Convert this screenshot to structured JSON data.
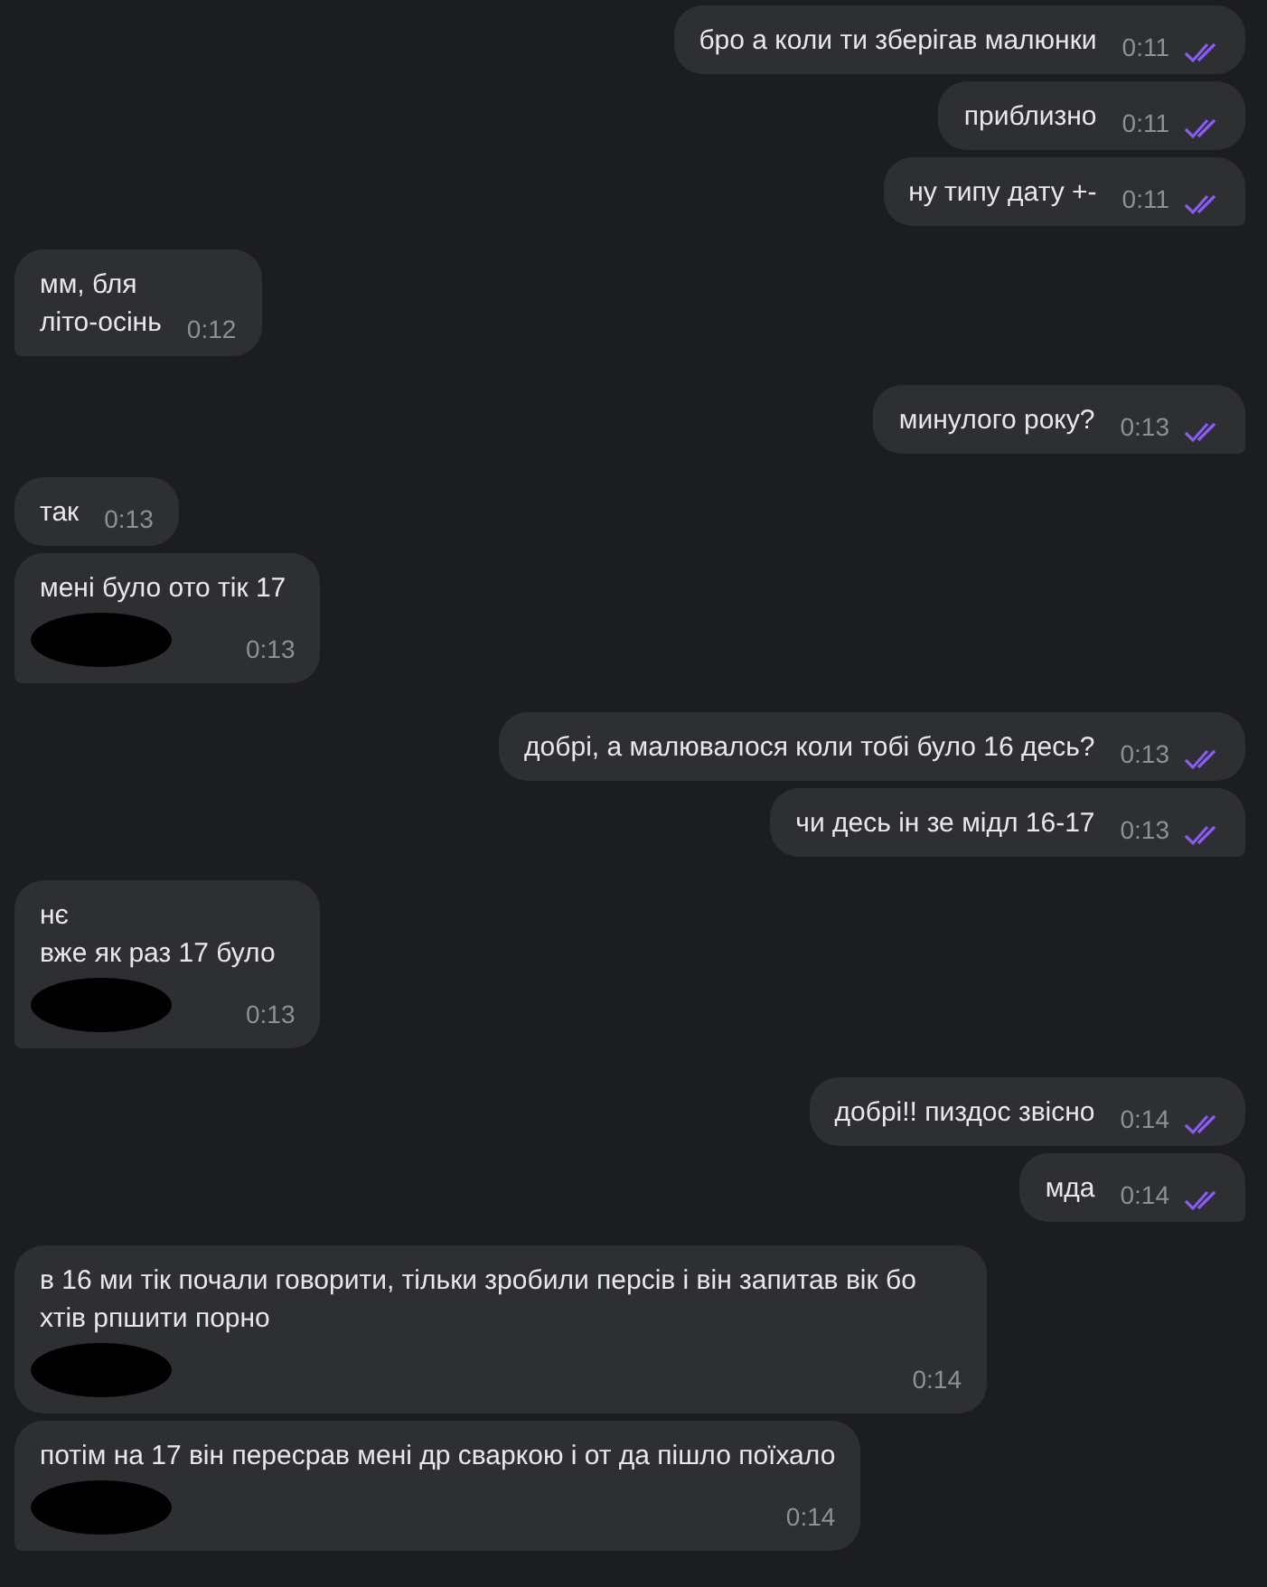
{
  "groups": [
    {
      "outgoing": true,
      "messages": [
        {
          "lines": [
            "бро а коли ти зберігав малюнки"
          ],
          "time": "0:11",
          "read": true,
          "redacted": false
        },
        {
          "lines": [
            "приблизно"
          ],
          "time": "0:11",
          "read": true,
          "redacted": false
        },
        {
          "lines": [
            "ну типу дату +-"
          ],
          "time": "0:11",
          "read": true,
          "redacted": false
        }
      ]
    },
    {
      "outgoing": false,
      "messages": [
        {
          "lines": [
            "мм, бля",
            "літо-осінь"
          ],
          "time": "0:12",
          "redacted": false
        }
      ]
    },
    {
      "outgoing": true,
      "messages": [
        {
          "lines": [
            "минулого року?"
          ],
          "time": "0:13",
          "read": true,
          "redacted": false
        }
      ]
    },
    {
      "outgoing": false,
      "messages": [
        {
          "lines": [
            "так"
          ],
          "time": "0:13",
          "redacted": false
        },
        {
          "lines": [
            "мені було ото тік 17"
          ],
          "time": "0:13",
          "redacted": true
        }
      ]
    },
    {
      "outgoing": true,
      "messages": [
        {
          "lines": [
            "добрі, а малювалося коли тобі було 16 десь?"
          ],
          "time": "0:13",
          "read": true,
          "redacted": false
        },
        {
          "lines": [
            "чи десь ін зе мідл 16-17"
          ],
          "time": "0:13",
          "read": true,
          "redacted": false
        }
      ]
    },
    {
      "outgoing": false,
      "messages": [
        {
          "lines": [
            "нє",
            "вже як раз 17 було"
          ],
          "time": "0:13",
          "redacted": true
        }
      ]
    },
    {
      "outgoing": true,
      "messages": [
        {
          "lines": [
            "добрі!! пиздос звісно"
          ],
          "time": "0:14",
          "read": true,
          "redacted": false
        },
        {
          "lines": [
            "мда"
          ],
          "time": "0:14",
          "read": true,
          "redacted": false
        }
      ]
    },
    {
      "outgoing": false,
      "messages": [
        {
          "lines": [
            "в 16 ми тік почали говорити, тільки зробили персів і він запитав вік бо хтів рпшити порно"
          ],
          "time": "0:14",
          "redacted": true
        },
        {
          "lines": [
            "потім на 17 він пересрав мені др сваркою і от да пішло поїхало"
          ],
          "time": "0:14",
          "redacted": true
        }
      ]
    }
  ]
}
